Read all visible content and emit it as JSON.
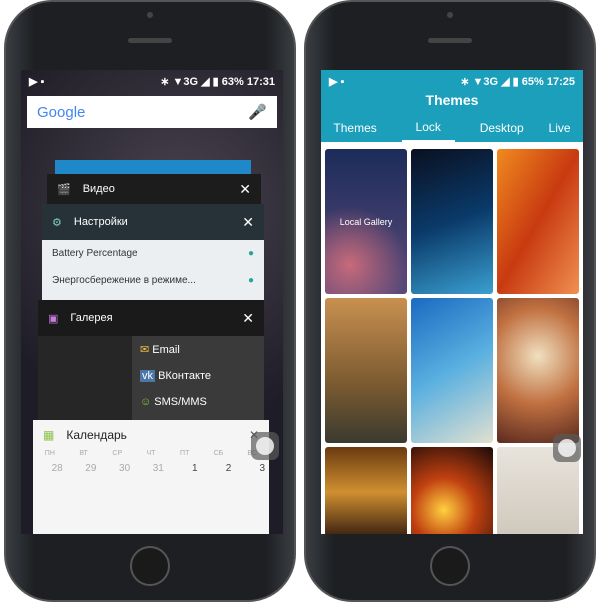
{
  "left": {
    "status": {
      "time": "17:31",
      "battery": "63%",
      "network": "3G"
    },
    "search": {
      "logo": "Google",
      "mic": "mic-icon"
    },
    "cards": [
      {
        "title": "Видео",
        "icon": "video-clapper-icon"
      },
      {
        "title": "Настройки",
        "icon": "gear-icon"
      },
      {
        "title": "Галерея",
        "icon": "gallery-icon"
      },
      {
        "title": "Календарь",
        "icon": "calendar-icon"
      }
    ],
    "settings_rows": [
      {
        "label": "Battery Percentage",
        "on": true
      },
      {
        "label": "Энергосбережение в режиме...",
        "on": true
      }
    ],
    "share_items": [
      {
        "label": "Email",
        "icon": "email-icon"
      },
      {
        "label": "ВКонтакте",
        "icon": "vk-icon"
      },
      {
        "label": "SMS/MMS",
        "icon": "sms-icon"
      }
    ],
    "calendar": {
      "days": [
        "ПН",
        "ВТ",
        "СР",
        "ЧТ",
        "ПТ",
        "СБ",
        "ВС"
      ],
      "dates": [
        "28",
        "29",
        "30",
        "31",
        "1",
        "2",
        "3"
      ]
    }
  },
  "right": {
    "status": {
      "time": "17:25",
      "battery": "65%",
      "network": "3G"
    },
    "title": "Themes",
    "tabs": [
      "Themes",
      "Lock",
      "Desktop",
      "Live"
    ],
    "active_tab": "Lock",
    "local_gallery": "Local Gallery",
    "accent": "#1b9fbb"
  }
}
